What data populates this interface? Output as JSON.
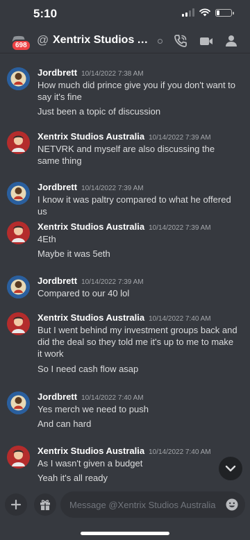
{
  "status_bar": {
    "time": "5:10"
  },
  "header": {
    "badge": "698",
    "at_symbol": "@",
    "title": "Xentrix Studios Aus..."
  },
  "messages": [
    {
      "author": "Jordbrett",
      "avatar": "jordbrett",
      "time": "10/14/2022 7:38 AM",
      "lines": [
        "How much did prince give you if you don't want to say it's fine",
        "Just been a topic of discussion"
      ]
    },
    {
      "author": "Xentrix Studios Australia",
      "avatar": "xentrix",
      "time": "10/14/2022 7:39 AM",
      "lines": [
        "NETVRK and myself are also discussing the same thing"
      ]
    },
    {
      "author": "Jordbrett",
      "avatar": "jordbrett",
      "time": "10/14/2022 7:39 AM",
      "lines": [
        "I know it was paltry compared to what he offered us"
      ]
    },
    {
      "author": "Xentrix Studios Australia",
      "avatar": "xentrix",
      "time": "10/14/2022 7:39 AM",
      "lines": [
        "4Eth",
        "Maybe it was 5eth"
      ]
    },
    {
      "author": "Jordbrett",
      "avatar": "jordbrett",
      "time": "10/14/2022 7:39 AM",
      "lines": [
        "Compared to our 40 lol"
      ]
    },
    {
      "author": "Xentrix Studios Australia",
      "avatar": "xentrix",
      "time": "10/14/2022 7:40 AM",
      "lines": [
        "But I went behind my investment groups back and did the deal so they told me it's up to me to make it work",
        "So I need cash flow asap"
      ]
    },
    {
      "author": "Jordbrett",
      "avatar": "jordbrett",
      "time": "10/14/2022 7:40 AM",
      "lines": [
        "Yes merch we need to push",
        "And can hard"
      ]
    },
    {
      "author": "Xentrix Studios Australia",
      "avatar": "xentrix",
      "time": "10/14/2022 7:40 AM",
      "lines": [
        "As I wasn't given a budget",
        "Yeah it's all ready"
      ]
    }
  ],
  "composer": {
    "placeholder": "Message @Xentrix Studios Australia"
  },
  "icons": {
    "back": "discord-back-icon",
    "call": "phone-call-icon",
    "video": "video-camera-icon",
    "members": "member-list-icon",
    "scroll": "chevron-down-icon",
    "add": "plus-icon",
    "gift": "gift-icon",
    "emoji": "emoji-icon"
  },
  "colors": {
    "background": "#36393f",
    "badge": "#ed4245",
    "input": "#2f3136",
    "username": "#ffffff",
    "timestamp": "#a3a6aa"
  }
}
